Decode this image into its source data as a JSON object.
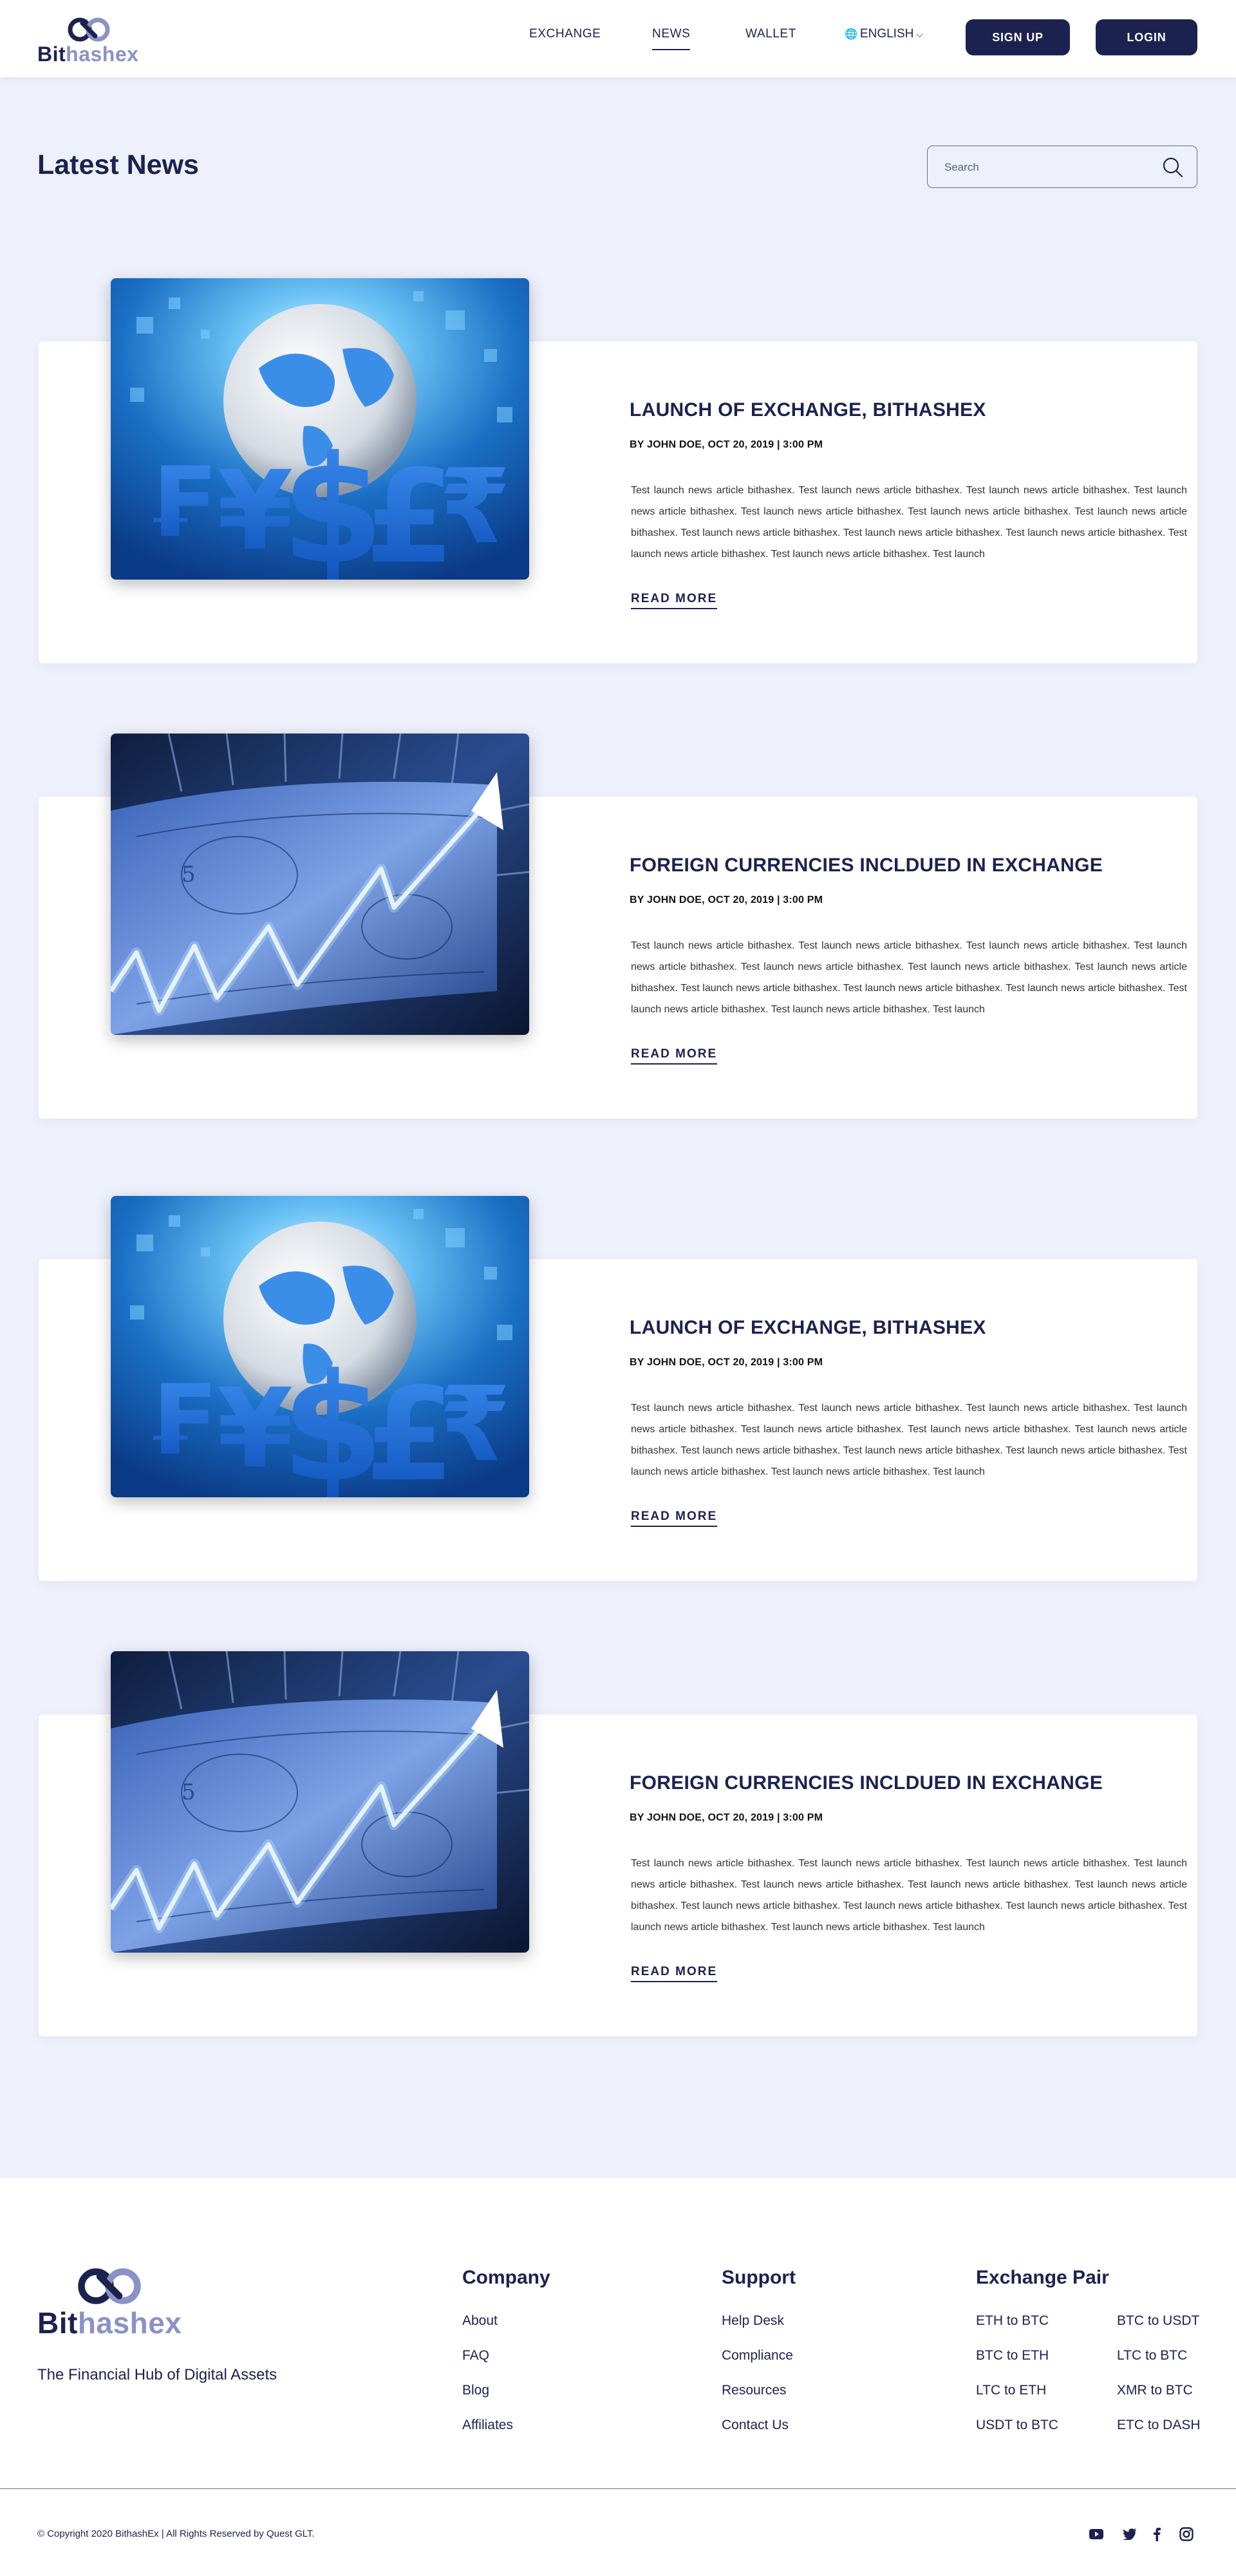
{
  "header": {
    "logo_part1": "Bit",
    "logo_part2": "hashex",
    "nav": {
      "exchange": "EXCHANGE",
      "news": "NEWS",
      "wallet": "WALLET"
    },
    "language": "ENGLISH",
    "signup_label": "SIGN UP",
    "login_label": "LOGIN"
  },
  "page": {
    "title": "Latest News",
    "search_placeholder": "Search"
  },
  "articles": [
    {
      "title": "LAUNCH OF EXCHANGE, BITHASHEX",
      "meta": "BY JOHN DOE, OCT 20, 2019 | 3:00 PM",
      "body": "Test launch news article bithashex. Test launch news article bithashex. Test launch news article bithashex. Test launch news article bithashex. Test launch news article bithashex. Test launch news article bithashex. Test launch news article bithashex. Test launch news article bithashex. Test launch news article bithashex. Test launch news article bithashex. Test launch news article bithashex. Test launch news article bithashex. Test launch",
      "read_more": "READ MORE",
      "image": "currency-globe-image"
    },
    {
      "title": "FOREIGN CURRENCIES INCLDUED IN EXCHANGE",
      "meta": "BY JOHN DOE, OCT 20, 2019 | 3:00 PM",
      "body": "Test launch news article bithashex. Test launch news article bithashex. Test launch news article bithashex. Test launch news article bithashex. Test launch news article bithashex. Test launch news article bithashex. Test launch news article bithashex. Test launch news article bithashex. Test launch news article bithashex. Test launch news article bithashex. Test launch news article bithashex. Test launch news article bithashex. Test launch",
      "read_more": "READ MORE",
      "image": "dollar-arrow-image"
    },
    {
      "title": "LAUNCH OF EXCHANGE, BITHASHEX",
      "meta": "BY JOHN DOE, OCT 20, 2019 | 3:00 PM",
      "body": "Test launch news article bithashex. Test launch news article bithashex. Test launch news article bithashex. Test launch news article bithashex. Test launch news article bithashex. Test launch news article bithashex. Test launch news article bithashex. Test launch news article bithashex. Test launch news article bithashex. Test launch news article bithashex. Test launch news article bithashex. Test launch news article bithashex. Test launch",
      "read_more": "READ MORE",
      "image": "currency-globe-image"
    },
    {
      "title": "FOREIGN CURRENCIES INCLDUED IN EXCHANGE",
      "meta": "BY JOHN DOE, OCT 20, 2019 | 3:00 PM",
      "body": "Test launch news article bithashex. Test launch news article bithashex. Test launch news article bithashex. Test launch news article bithashex. Test launch news article bithashex. Test launch news article bithashex. Test launch news article bithashex. Test launch news article bithashex. Test launch news article bithashex. Test launch news article bithashex. Test launch news article bithashex. Test launch news article bithashex. Test launch",
      "read_more": "READ MORE",
      "image": "dollar-arrow-image"
    }
  ],
  "footer": {
    "logo_part1": "Bit",
    "logo_part2": "hashex",
    "tagline": "The Financial Hub of Digital Assets",
    "company": {
      "heading": "Company",
      "links": [
        "About",
        "FAQ",
        "Blog",
        "Affiliates"
      ]
    },
    "support": {
      "heading": "Support",
      "links": [
        "Help Desk",
        "Compliance",
        "Resources",
        "Contact Us"
      ]
    },
    "exchange_pair": {
      "heading": "Exchange Pair",
      "col1": [
        "ETH to BTC",
        "BTC to ETH",
        "LTC to ETH",
        "USDT to BTC"
      ],
      "col2": [
        "BTC to USDT",
        "LTC to BTC",
        "XMR to BTC",
        "ETC to DASH"
      ]
    },
    "copyright": "© Copyright 2020 BithashEx | All Rights Reserved by Quest GLT.",
    "social_icons": [
      "youtube-icon",
      "twitter-icon",
      "facebook-icon",
      "instagram-icon"
    ]
  },
  "colors": {
    "primary": "#1c2250",
    "accent_light": "#8a92c6",
    "page_background": "#eef0fc",
    "card_background": "#ffffff"
  }
}
